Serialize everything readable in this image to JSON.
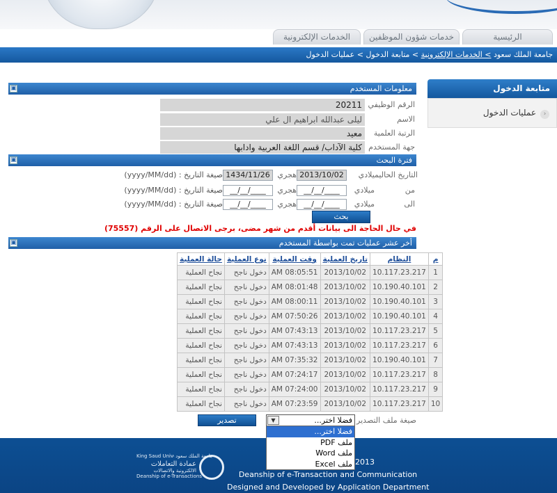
{
  "tabs": [
    "الرئيسية",
    "خدمات شؤون الموظفين",
    "الخدمات الإلكترونية"
  ],
  "breadcrumb": {
    "root": "جامعة الملك سعود",
    "link": "> الخدمات الإلكترونية",
    "rest": "> متابعة الدخول > عمليات الدخول"
  },
  "sidebar": {
    "title": "متابعة الدخول",
    "items": [
      {
        "label": "عمليات الدخول"
      }
    ]
  },
  "user_info": {
    "title": "معلومات المستخدم",
    "fields": [
      {
        "label": "الرقم الوظيفي",
        "value": "20211"
      },
      {
        "label": "الاسم",
        "value": "ليلى عبدالله ابراهيم ال علي"
      },
      {
        "label": "الرتبة العلمية",
        "value": "معيد"
      },
      {
        "label": "جهة المستخدم",
        "value": "كلية الآداب/ قسم اللغة العربية وادابها"
      }
    ]
  },
  "search": {
    "title": "فترة البحث",
    "current_label": "التاريخ الحالي",
    "from_label": "من",
    "to_label": "الى",
    "gregorian": "ميلادي",
    "hijri": "هجري",
    "current_greg": "2013/10/02",
    "current_hijri": "1434/11/26",
    "blank_date": "__/__/____",
    "format_hint": "صيغة التاريخ : (yyyy/MM/dd)",
    "button": "بحث",
    "notice": "في حال الحاجة الى بيانات أقدم من شهر مضى، برجى الاتصال على الرقم (75557)"
  },
  "ops": {
    "title": "أخر عشر عمليات تمت بواسطة المستخدم",
    "columns": [
      "م",
      "النظام",
      "تاريخ العملية",
      "وقت العملية",
      "نوع العملية",
      "حالة العملية"
    ],
    "rows": [
      [
        "1",
        "10.117.23.217",
        "2013/10/02",
        "AM 08:05:51",
        "دخول ناجح",
        "نجاح العملية"
      ],
      [
        "2",
        "10.190.40.101",
        "2013/10/02",
        "AM 08:01:48",
        "دخول ناجح",
        "نجاح العملية"
      ],
      [
        "3",
        "10.190.40.101",
        "2013/10/02",
        "AM 08:00:11",
        "دخول ناجح",
        "نجاح العملية"
      ],
      [
        "4",
        "10.190.40.101",
        "2013/10/02",
        "AM 07:50:26",
        "دخول ناجح",
        "نجاح العملية"
      ],
      [
        "5",
        "10.117.23.217",
        "2013/10/02",
        "AM 07:43:13",
        "دخول ناجح",
        "نجاح العملية"
      ],
      [
        "6",
        "10.117.23.217",
        "2013/10/02",
        "AM 07:43:13",
        "دخول ناجح",
        "نجاح العملية"
      ],
      [
        "7",
        "10.190.40.101",
        "2013/10/02",
        "AM 07:35:32",
        "دخول ناجح",
        "نجاح العملية"
      ],
      [
        "8",
        "10.117.23.217",
        "2013/10/02",
        "AM 07:24:17",
        "دخول ناجح",
        "نجاح العملية"
      ],
      [
        "9",
        "10.117.23.217",
        "2013/10/02",
        "AM 07:24:00",
        "دخول ناجح",
        "نجاح العملية"
      ],
      [
        "10",
        "10.117.23.217",
        "2013/10/02",
        "AM 07:23:59",
        "دخول ناجح",
        "نجاح العملية"
      ]
    ],
    "export_label": "صيغة ملف التصدير",
    "export_selected": "فضلا اختر...",
    "export_button": "تصدير",
    "export_options": [
      "فضلا اختر...",
      "ملف PDF",
      "ملف Word",
      "ملف Excel"
    ]
  },
  "footer": {
    "year": "2013",
    "line1": "Deanship of e-Transaction and Communication",
    "line2": "Designed and Developed by Application Department",
    "logo_en": "King Saud University",
    "logo_ar_small": "جامعة الملك سعود",
    "logo_ar": "عمادة التعاملات",
    "logo_ar2": "الالكترونية والاتصالات",
    "logo_en2": "Deanship of e-Transactions"
  },
  "colors": {
    "accent": "#1f5fa7",
    "notice": "#e00000"
  }
}
